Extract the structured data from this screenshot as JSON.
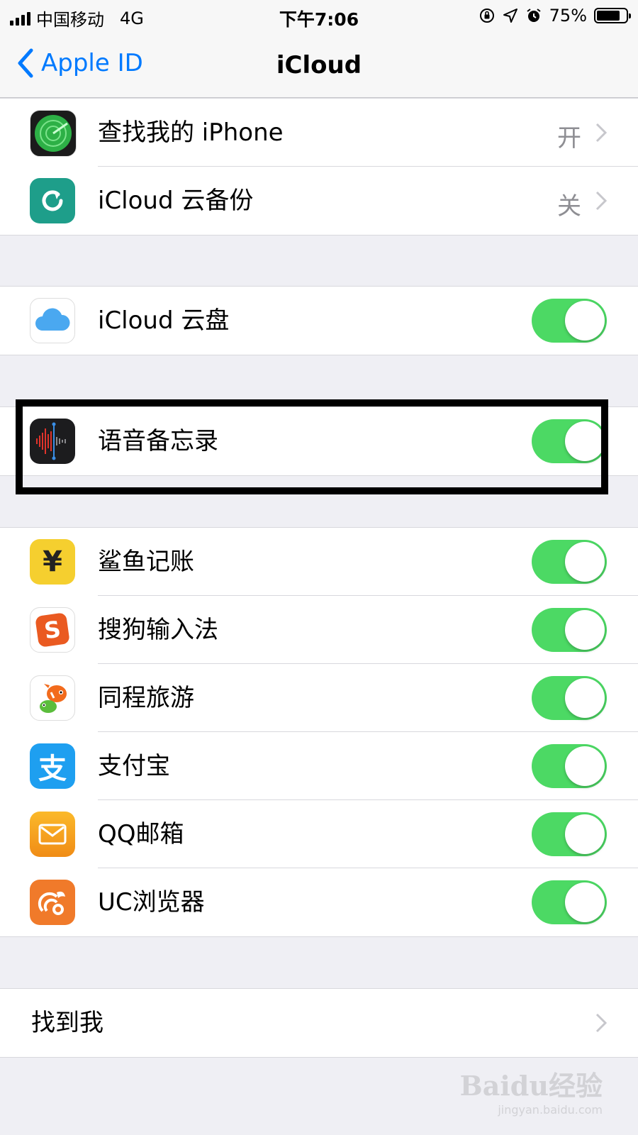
{
  "status_bar": {
    "carrier": "中国移动",
    "network": "4G",
    "time": "下午7:06",
    "battery": "75%",
    "battery_level": 0.75
  },
  "nav": {
    "back_label": "Apple ID",
    "title": "iCloud"
  },
  "groups": {
    "top": [
      {
        "label": "查找我的 iPhone",
        "value": "开",
        "icon": "find-my-iphone-icon"
      },
      {
        "label": "iCloud 云备份",
        "value": "关",
        "icon": "icloud-backup-icon"
      }
    ],
    "drive": [
      {
        "label": "iCloud 云盘",
        "on": true,
        "icon": "icloud-drive-icon"
      }
    ],
    "voice": [
      {
        "label": "语音备忘录",
        "on": true,
        "icon": "voice-memos-icon"
      }
    ],
    "apps": [
      {
        "label": "鲨鱼记账",
        "on": true,
        "icon": "yuan-icon"
      },
      {
        "label": "搜狗输入法",
        "on": true,
        "icon": "sogou-icon"
      },
      {
        "label": "同程旅游",
        "on": true,
        "icon": "tongcheng-fish-icon"
      },
      {
        "label": "支付宝",
        "on": true,
        "icon": "alipay-icon"
      },
      {
        "label": "QQ邮箱",
        "on": true,
        "icon": "mail-icon"
      },
      {
        "label": "UC浏览器",
        "on": true,
        "icon": "uc-squirrel-icon"
      }
    ],
    "find_me": [
      {
        "label": "找到我"
      }
    ]
  },
  "icons": {
    "yuan": "¥",
    "sogou": "S",
    "alipay": "支"
  },
  "colors": {
    "accent": "#007aff",
    "toggle_on": "#4cd964",
    "background": "#efeff4"
  },
  "watermark": {
    "logo": "Baidu经验",
    "url": "jingyan.baidu.com"
  }
}
